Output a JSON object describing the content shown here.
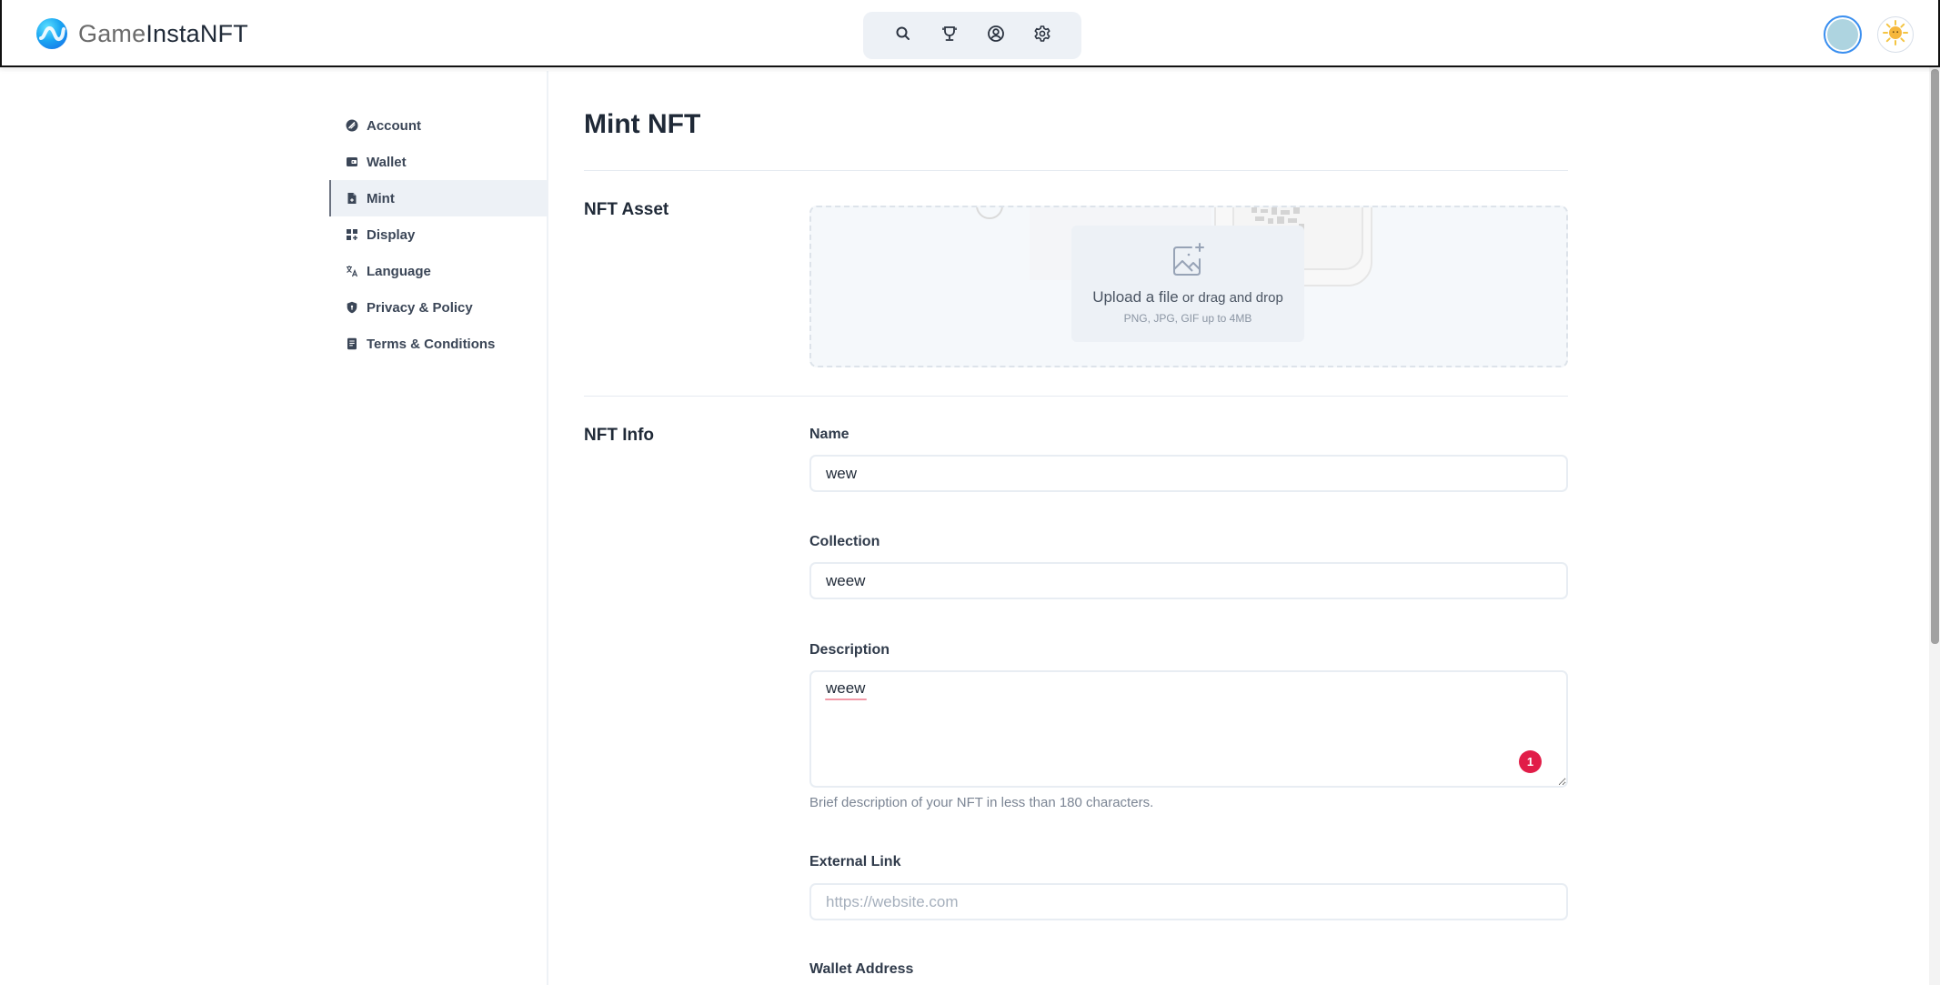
{
  "header": {
    "brand_light": "Game",
    "brand_dark": "InstaNFT",
    "icons": [
      "search-icon",
      "trophy-icon",
      "user-circle-icon",
      "gear-icon"
    ],
    "theme_icon": "sun-icon"
  },
  "colors": {
    "accent": "#3b8ff0",
    "active_bg": "#edf1f6",
    "badge": "#e11d48",
    "avatar_fill": "#aed4e0"
  },
  "sidebar": {
    "items": [
      {
        "label": "Account",
        "icon": "account-icon",
        "active": false
      },
      {
        "label": "Wallet",
        "icon": "wallet-icon",
        "active": false
      },
      {
        "label": "Mint",
        "icon": "document-icon",
        "active": true
      },
      {
        "label": "Display",
        "icon": "grid-add-icon",
        "active": false
      },
      {
        "label": "Language",
        "icon": "translate-icon",
        "active": false
      },
      {
        "label": "Privacy & Policy",
        "icon": "shield-icon",
        "active": false
      },
      {
        "label": "Terms & Conditions",
        "icon": "page-icon",
        "active": false
      }
    ]
  },
  "main": {
    "title": "Mint NFT",
    "asset_section": {
      "label": "NFT Asset",
      "upload_link": "Upload a file",
      "upload_rest": " or drag and drop",
      "upload_hint": "PNG, JPG, GIF up to 4MB"
    },
    "info_section": {
      "label": "NFT Info",
      "name": {
        "label": "Name",
        "value": "wew"
      },
      "collection": {
        "label": "Collection",
        "value": "weew"
      },
      "description": {
        "label": "Description",
        "value": "weew",
        "help": "Brief description of your NFT in less than 180 characters.",
        "badge_count": "1"
      },
      "external_link": {
        "label": "External Link",
        "value": "",
        "placeholder": "https://website.com"
      },
      "wallet_address": {
        "label": "Wallet Address"
      }
    }
  }
}
